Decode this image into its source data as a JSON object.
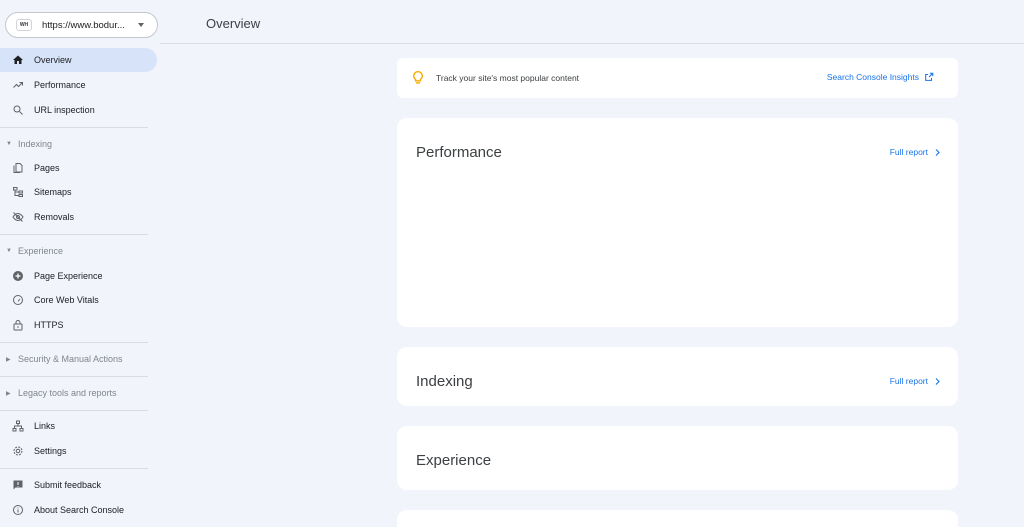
{
  "property": {
    "favicon_text": "WH",
    "url": "https://www.bodur..."
  },
  "header": {
    "title": "Overview"
  },
  "nav_top": [
    {
      "label": "Overview",
      "icon": "home-icon"
    },
    {
      "label": "Performance",
      "icon": "trending-icon"
    },
    {
      "label": "URL inspection",
      "icon": "search-icon"
    }
  ],
  "sections": {
    "indexing": {
      "label": "Indexing",
      "items": [
        {
          "label": "Pages",
          "icon": "pages-icon"
        },
        {
          "label": "Sitemaps",
          "icon": "sitemap-icon"
        },
        {
          "label": "Removals",
          "icon": "eye-off-icon"
        }
      ]
    },
    "experience": {
      "label": "Experience",
      "items": [
        {
          "label": "Page Experience",
          "icon": "plus-circle-icon"
        },
        {
          "label": "Core Web Vitals",
          "icon": "gauge-icon"
        },
        {
          "label": "HTTPS",
          "icon": "lock-icon"
        }
      ]
    },
    "security": {
      "label": "Security & Manual Actions"
    },
    "legacy": {
      "label": "Legacy tools and reports"
    }
  },
  "nav_bottom": [
    {
      "label": "Links",
      "icon": "links-icon"
    },
    {
      "label": "Settings",
      "icon": "gear-icon"
    }
  ],
  "nav_footer": [
    {
      "label": "Submit feedback",
      "icon": "feedback-icon"
    },
    {
      "label": "About Search Console",
      "icon": "info-icon"
    }
  ],
  "insights": {
    "text": "Track your site's most popular content",
    "link": "Search Console Insights"
  },
  "cards": {
    "performance": {
      "title": "Performance",
      "link": "Full report"
    },
    "indexing": {
      "title": "Indexing",
      "link": "Full report"
    },
    "experience": {
      "title": "Experience"
    }
  },
  "colors": {
    "accent": "#1a73e8",
    "active_bg": "#d6e3f8",
    "page_bg": "#f1f4fb"
  }
}
